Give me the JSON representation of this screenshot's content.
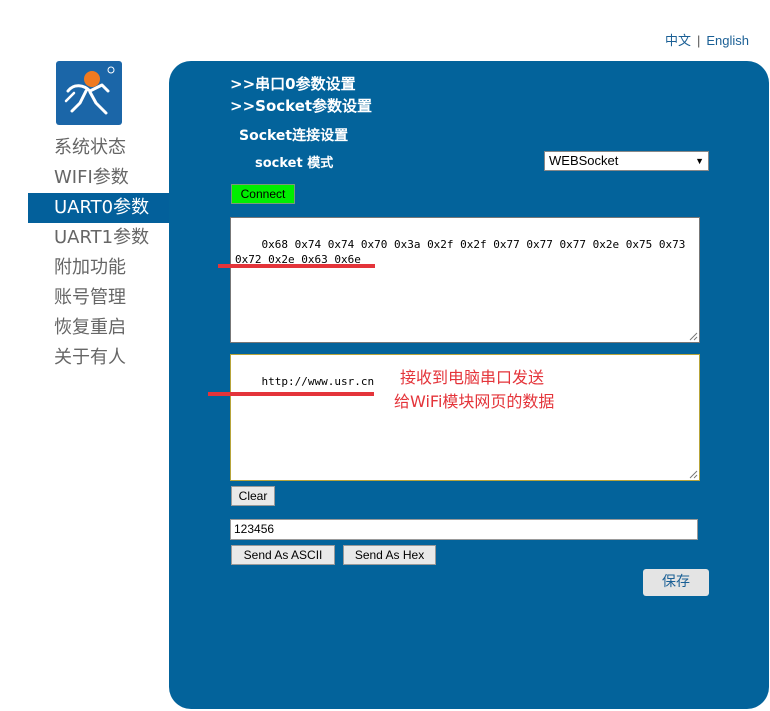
{
  "language": {
    "chinese": "中文",
    "separator": "|",
    "english": "English"
  },
  "sidebar": {
    "items": [
      {
        "label": "系统状态",
        "active": false
      },
      {
        "label": "WIFI参数",
        "active": false
      },
      {
        "label": "UART0参数",
        "active": true
      },
      {
        "label": "UART1参数",
        "active": false
      },
      {
        "label": "附加功能",
        "active": false
      },
      {
        "label": "账号管理",
        "active": false
      },
      {
        "label": "恢复重启",
        "active": false
      },
      {
        "label": "关于有人",
        "active": false
      }
    ]
  },
  "panel": {
    "nav1": ">>串口0参数设置",
    "nav2": ">>Socket参数设置",
    "section_title": "Socket连接设置",
    "mode_label": "socket 模式",
    "mode_value": "WEBSocket",
    "connect_label": "Connect",
    "receive_text": "0x68 0x74 0x74 0x70 0x3a 0x2f 0x2f 0x77 0x77 0x77 0x2e 0x75 0x73 0x72 0x2e 0x63 0x6e",
    "send_area_text": "http://www.usr.cn",
    "clear_label": "Clear",
    "input_value": "123456",
    "send_ascii_label": "Send As ASCII",
    "send_hex_label": "Send As Hex",
    "save_label": "保存"
  },
  "annotation": {
    "line1": "接收到电脑串口发送",
    "line2": "给WiFi模块网页的数据"
  },
  "colors": {
    "panel": "#03639b",
    "sidebar_active": "#03609b",
    "connect_green": "#00ee00",
    "annotation_red": "#e4343a",
    "link_blue": "#1a5f95"
  }
}
